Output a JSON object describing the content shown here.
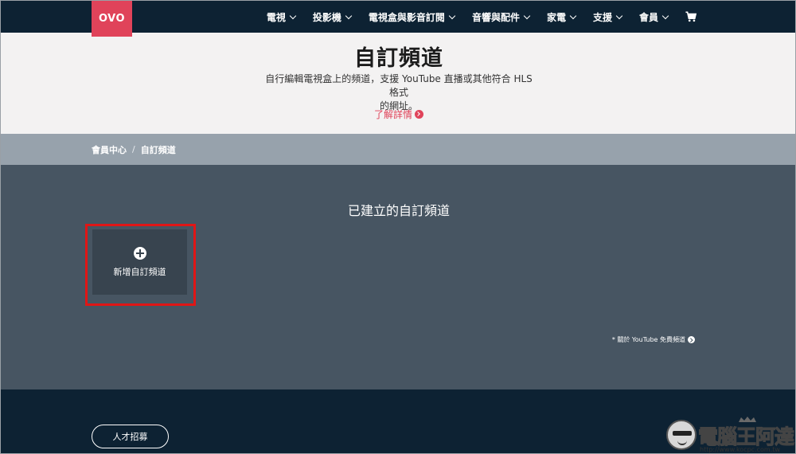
{
  "nav": {
    "logo": "OVO",
    "items": [
      {
        "label": "電視"
      },
      {
        "label": "投影機"
      },
      {
        "label": "電視盒與影音訂閱"
      },
      {
        "label": "音響與配件"
      },
      {
        "label": "家電"
      },
      {
        "label": "支援"
      },
      {
        "label": "會員"
      }
    ],
    "cart_icon": "cart-icon"
  },
  "hero": {
    "title": "自訂頻道",
    "description_line1": "自行編輯電視盒上的頻道，支援 YouTube 直播或其他符合 HLS 格式",
    "description_line2": "的網址。",
    "learn_more": "了解詳情"
  },
  "breadcrumb": {
    "items": [
      "會員中心",
      "自訂頻道"
    ],
    "separator": "/"
  },
  "main": {
    "section_title": "已建立的自訂頻道",
    "add_channel_label": "新增自訂頻道",
    "youtube_note": "* 關於 YouTube 免費頻道"
  },
  "footer": {
    "career_button": "人才招募"
  },
  "watermark": {
    "text": "電腦王阿達",
    "url": "http://www.kocpc.com.tw"
  },
  "colors": {
    "nav_bg": "#0d2233",
    "brand": "#e0435a",
    "hero_bg": "#f3f2f2",
    "breadcrumb_bg": "#97a2ac",
    "main_bg": "#475562",
    "card_bg": "#38444f",
    "highlight": "#e01616"
  }
}
